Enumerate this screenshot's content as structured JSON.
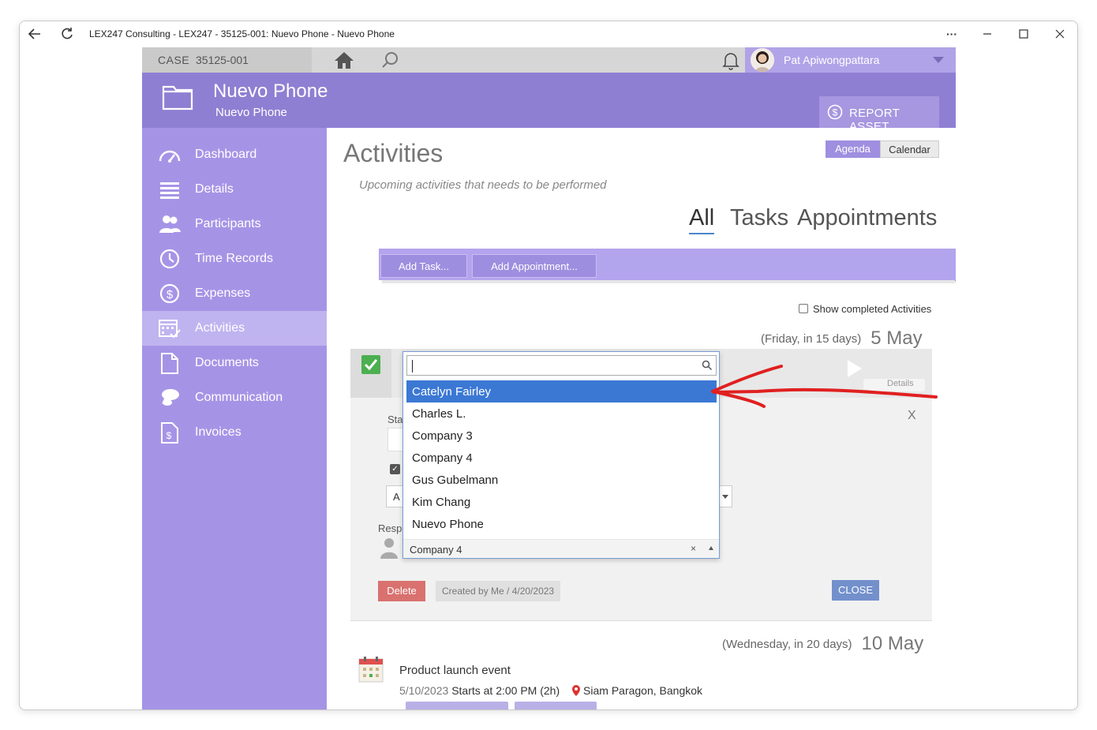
{
  "window": {
    "title": "LEX247 Consulting - LEX247 - 35125-001: Nuevo Phone - Nuevo Phone",
    "more_label": "···"
  },
  "topbar": {
    "case_label": "CASE",
    "case_number": "35125-001",
    "user_name": "Pat Apiwongpattara"
  },
  "header": {
    "title": "Nuevo Phone",
    "subtitle": "Nuevo Phone",
    "report_button": "REPORT ASSET"
  },
  "sidebar": {
    "items": [
      {
        "label": "Dashboard",
        "icon": "dashboard-icon"
      },
      {
        "label": "Details",
        "icon": "list-icon"
      },
      {
        "label": "Participants",
        "icon": "people-icon"
      },
      {
        "label": "Time Records",
        "icon": "clock-icon"
      },
      {
        "label": "Expenses",
        "icon": "dollar-icon"
      },
      {
        "label": "Activities",
        "icon": "calendar-check-icon",
        "active": true
      },
      {
        "label": "Documents",
        "icon": "document-icon"
      },
      {
        "label": "Communication",
        "icon": "chat-icon"
      },
      {
        "label": "Invoices",
        "icon": "invoice-icon"
      }
    ]
  },
  "main": {
    "title": "Activities",
    "subtitle": "Upcoming activities that needs to be performed",
    "view_toggle": {
      "agenda": "Agenda",
      "calendar": "Calendar"
    },
    "filter_tabs": {
      "all": "All",
      "tasks": "Tasks",
      "appointments": "Appointments"
    },
    "actions": {
      "add_task": "Add Task...",
      "add_appointment": "Add Appointment..."
    },
    "show_completed": "Show completed Activities",
    "groups": [
      {
        "relative": "(Friday, in 15 days)",
        "date": "5 May"
      },
      {
        "relative": "(Wednesday, in 20 days)",
        "date": "10 May"
      }
    ]
  },
  "panel": {
    "status_label_partial": "Sta",
    "field_partial": "A",
    "responsible_label_partial": "Resp",
    "details_partial": "Details",
    "close_x": "X",
    "delete": "Delete",
    "created": "Created by Me / 4/20/2023",
    "close": "CLOSE"
  },
  "dropdown": {
    "search_value": "",
    "options": [
      "Catelyn Fairley",
      "Charles L.",
      "Company 3",
      "Company 4",
      "Gus Gubelmann",
      "Kim Chang",
      "Nuevo Phone"
    ],
    "highlighted": "Catelyn Fairley",
    "selected_value": "Company 4",
    "clear_glyph": "×"
  },
  "event": {
    "title": "Product launch event",
    "date": "5/10/2023",
    "time": "Starts at 2:00 PM (2h)",
    "location": "Siam Paragon, Bangkok"
  },
  "colors": {
    "header": "#8f7fd3",
    "sidebar": "#a594e6",
    "highlight": "#3b78d4",
    "annotation_arrow": "#e02020"
  }
}
